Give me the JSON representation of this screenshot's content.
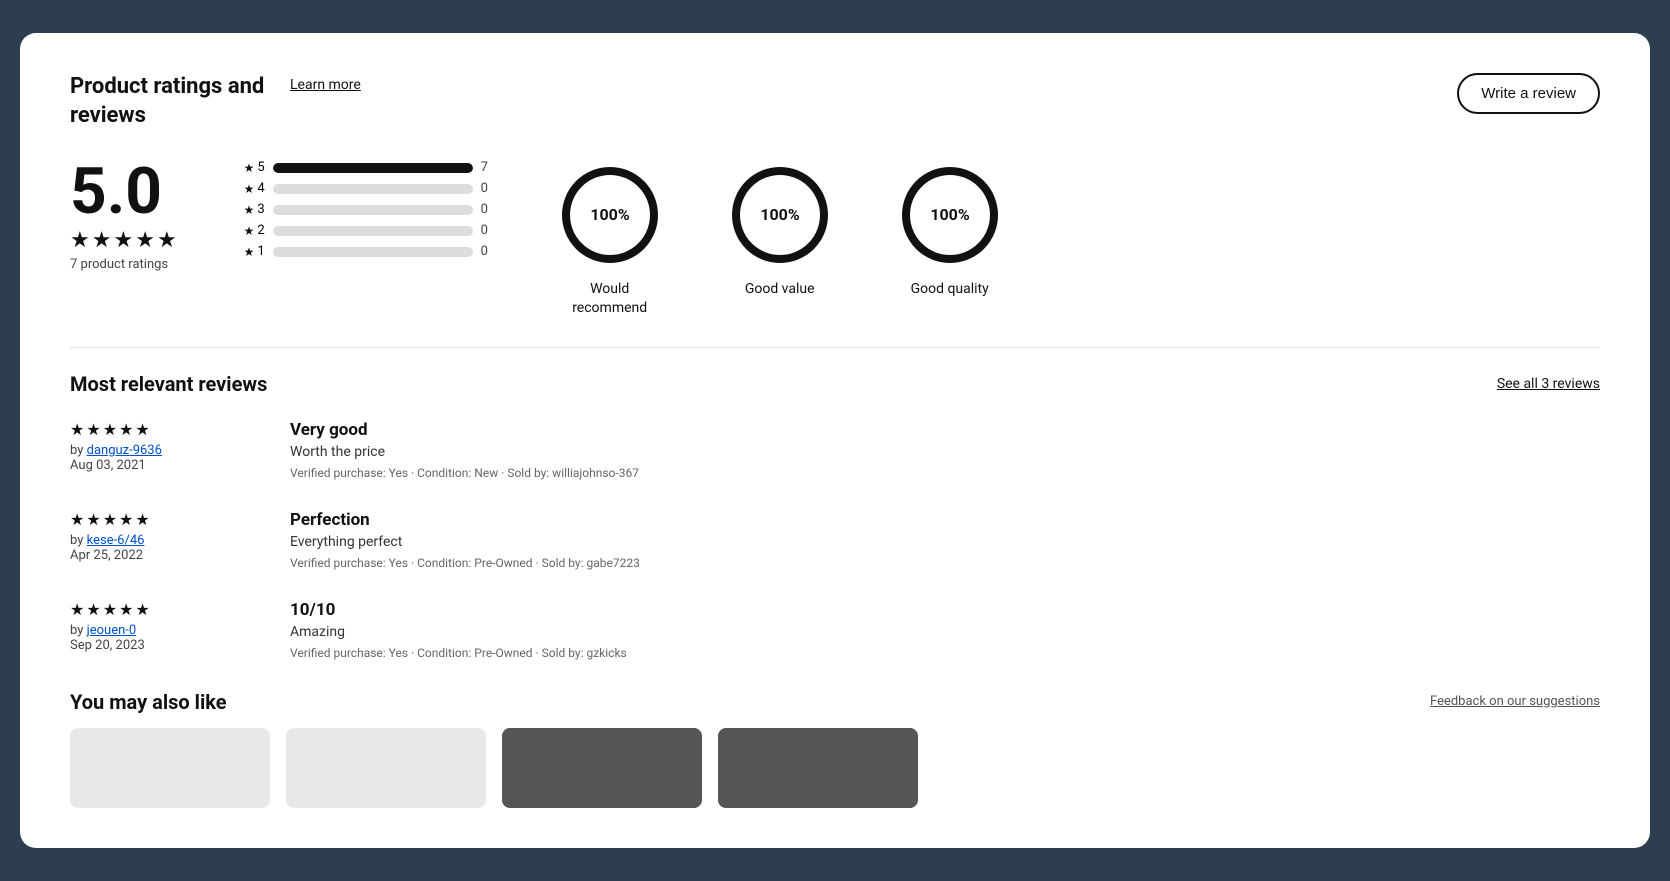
{
  "header": {
    "title": "Product ratings and reviews",
    "learn_more_label": "Learn more",
    "write_review_label": "Write a review"
  },
  "ratings_overview": {
    "score": "5.0",
    "stars": [
      "★",
      "★",
      "★",
      "★",
      "★"
    ],
    "rating_count": "7 product ratings",
    "bar_chart": [
      {
        "label": "5",
        "fill_pct": 100,
        "count": "7"
      },
      {
        "label": "4",
        "fill_pct": 0,
        "count": "0"
      },
      {
        "label": "3",
        "fill_pct": 0,
        "count": "0"
      },
      {
        "label": "2",
        "fill_pct": 0,
        "count": "0"
      },
      {
        "label": "1",
        "fill_pct": 0,
        "count": "0"
      }
    ],
    "gauges": [
      {
        "value": "100%",
        "label": "Would recommend"
      },
      {
        "value": "100%",
        "label": "Good value"
      },
      {
        "value": "100%",
        "label": "Good quality"
      }
    ]
  },
  "reviews_section": {
    "title": "Most relevant reviews",
    "see_all_label": "See all 3 reviews",
    "reviews": [
      {
        "stars": [
          "★",
          "★",
          "★",
          "★",
          "★"
        ],
        "by_label": "by",
        "author": "danguz-9636",
        "date": "Aug 03, 2021",
        "title": "Very good",
        "body": "Worth the price",
        "meta": "Verified purchase: Yes · Condition: New · Sold by: williajohnso-367"
      },
      {
        "stars": [
          "★",
          "★",
          "★",
          "★",
          "★"
        ],
        "by_label": "by",
        "author": "kese-6/46",
        "date": "Apr 25, 2022",
        "title": "Perfection",
        "body": "Everything perfect",
        "meta": "Verified purchase: Yes · Condition: Pre-Owned · Sold by: gabe7223"
      },
      {
        "stars": [
          "★",
          "★",
          "★",
          "★",
          "★"
        ],
        "by_label": "by",
        "author": "jeouen-0",
        "date": "Sep 20, 2023",
        "title": "10/10",
        "body": "Amazing",
        "meta": "Verified purchase: Yes · Condition: Pre-Owned · Sold by: gzkicks"
      }
    ]
  },
  "you_may_like": {
    "title": "You may also like",
    "feedback_label": "Feedback on our suggestions"
  }
}
